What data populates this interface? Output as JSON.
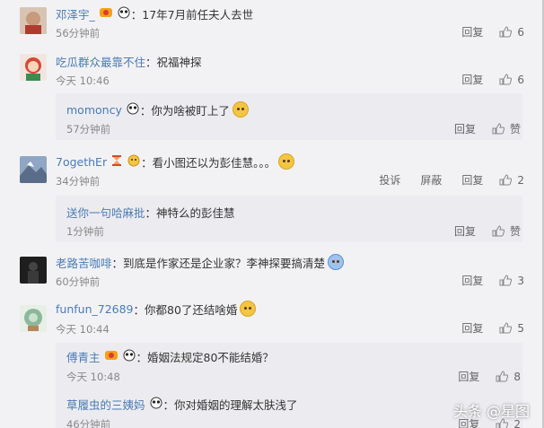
{
  "comments": [
    {
      "user": "邓泽宇_",
      "text": "：17年7月前任夫人去世",
      "time": "56分钟前",
      "reply_label": "回复",
      "likes": "6"
    },
    {
      "user": "吃瓜群众最靠不住",
      "text": "：祝福神探",
      "time": "今天 10:46",
      "reply_label": "回复",
      "likes": "6",
      "replies": [
        {
          "user": "momoncy",
          "text": "：你为啥被盯上了",
          "time": "57分钟前",
          "reply_label": "回复",
          "like_label": "赞"
        }
      ]
    },
    {
      "user": "7ogethEr",
      "text": "：看小图还以为彭佳慧。。。",
      "time": "34分钟前",
      "report_label": "投诉",
      "block_label": "屏蔽",
      "reply_label": "回复",
      "likes": "2",
      "replies": [
        {
          "user": "送你一句哈麻批",
          "text": "：神特么的彭佳慧",
          "time": "1分钟前",
          "reply_label": "回复",
          "like_label": "赞"
        }
      ]
    },
    {
      "user": "老路苦咖啡",
      "text": "：到底是作家还是企业家？李神探要搞清楚",
      "time": "60分钟前",
      "reply_label": "回复",
      "likes": "3"
    },
    {
      "user": "funfun_72689",
      "text": "：你都80了还结啥婚",
      "time": "今天 10:44",
      "reply_label": "回复",
      "likes": "5",
      "replies": [
        {
          "user": "傅青主",
          "text": "：婚姻法规定80不能结婚？",
          "time": "今天 10:48",
          "reply_label": "回复",
          "likes": "8"
        },
        {
          "user": "草履虫的三姨妈",
          "text": "：你对婚姻的理解太肤浅了",
          "time": "46分钟前",
          "reply_label": "回复",
          "likes": "2"
        }
      ]
    }
  ],
  "watermark": "头条 @星图",
  "colors": {
    "username": "#4a7ab5",
    "background": "#f2f2f5",
    "reply_bg": "#ececf0"
  },
  "icons": [
    "thumb-up-icon",
    "panda-badge-icon",
    "vip-badge-icon",
    "emoji-icon"
  ]
}
